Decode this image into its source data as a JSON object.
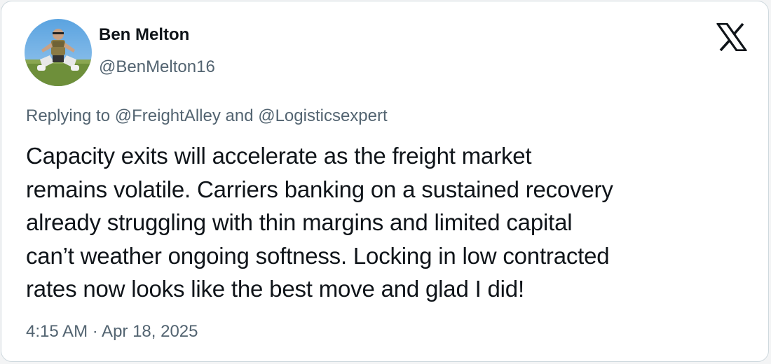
{
  "author": {
    "display_name": "Ben Melton",
    "handle": "@BenMelton16",
    "avatar_icon": "profile-photo"
  },
  "brand": {
    "logo_icon": "x-logo-icon"
  },
  "reply": {
    "prefix": "Replying to ",
    "mention_1": "@FreightAlley",
    "conjunction": " and ",
    "mention_2": "@Logisticsexpert"
  },
  "tweet": {
    "lines": [
      "Capacity exits will accelerate as the freight market",
      "remains volatile. Carriers banking on a sustained recovery",
      "already struggling with thin margins and limited capital",
      "can’t weather ongoing softness. Locking in low contracted",
      "rates now looks like the best move and glad I did!"
    ]
  },
  "meta": {
    "timestamp": "4:15 AM · Apr 18, 2025"
  },
  "colors": {
    "text_primary": "#0f1419",
    "text_secondary": "#536471",
    "border": "#cfd9de",
    "background": "#ffffff"
  }
}
